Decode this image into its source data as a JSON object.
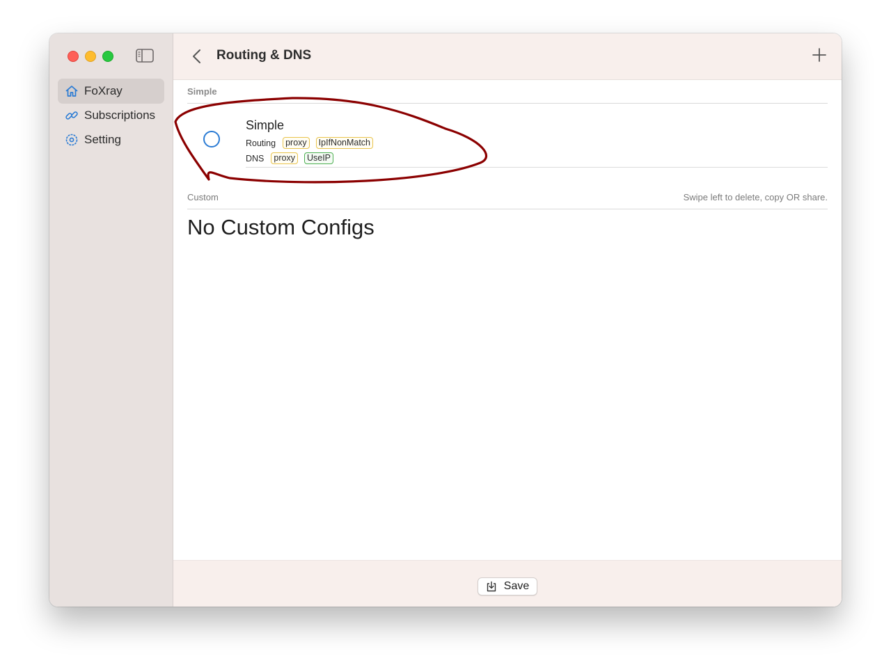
{
  "sidebar": {
    "items": [
      {
        "label": "FoXray",
        "icon": "house-icon",
        "active": true
      },
      {
        "label": "Subscriptions",
        "icon": "link-icon",
        "active": false
      },
      {
        "label": "Setting",
        "icon": "gear-icon",
        "active": false
      }
    ]
  },
  "toolbar": {
    "title": "Routing & DNS",
    "back_icon": "chevron-left-icon",
    "add_icon": "plus-icon"
  },
  "sections": {
    "simple": {
      "header": "Simple",
      "row": {
        "title": "Simple",
        "routing_label": "Routing",
        "routing_tags": [
          "proxy",
          "IpIfNonMatch"
        ],
        "dns_label": "DNS",
        "dns_tags": [
          "proxy",
          "UseIP"
        ],
        "selected": false
      }
    },
    "custom": {
      "header": "Custom",
      "hint": "Swipe left to delete, copy OR share.",
      "empty_text": "No Custom Configs"
    }
  },
  "bottom": {
    "save_label": "Save",
    "save_icon": "save-icon"
  },
  "colors": {
    "accent": "#2a7bd4",
    "annotation": "#8b0000",
    "tag_yellow": "#e9c34c",
    "tag_green": "#4caf50"
  }
}
